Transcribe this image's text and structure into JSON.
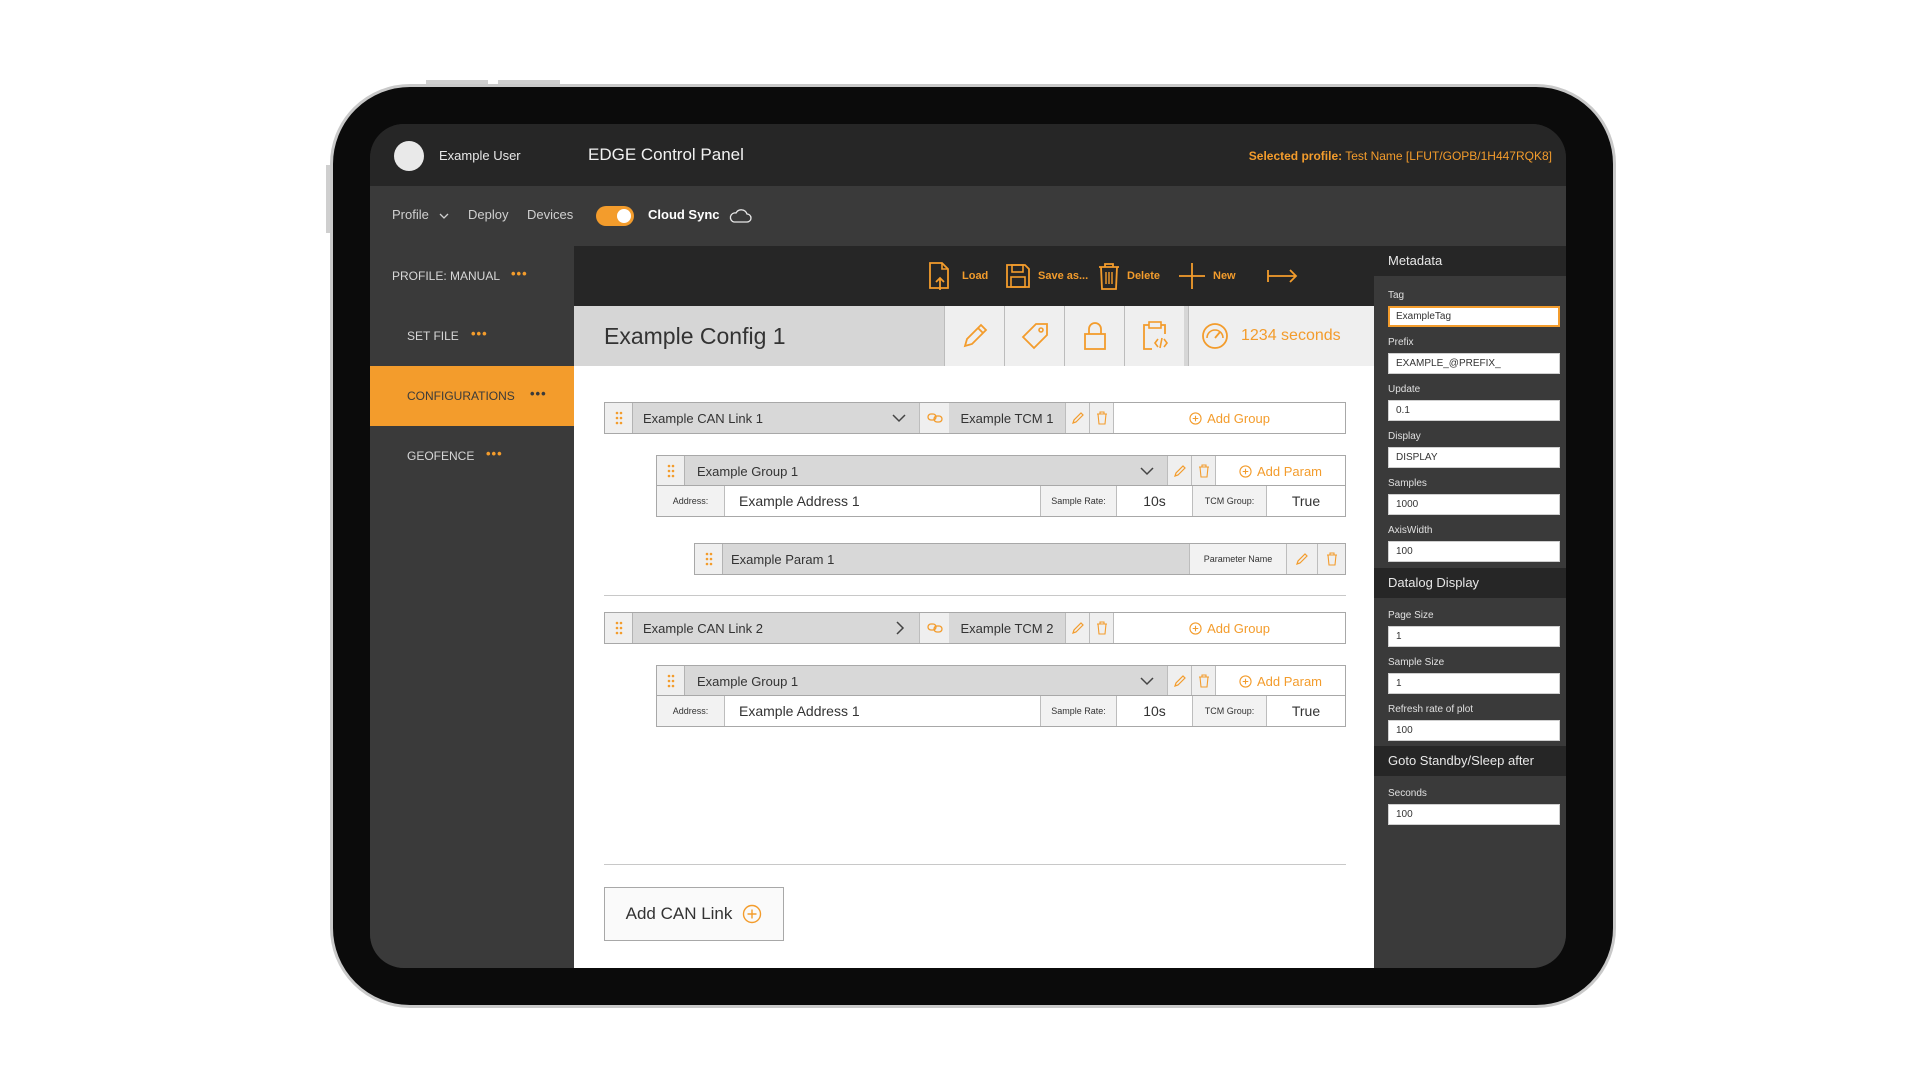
{
  "header": {
    "user_name": "Example User",
    "app_title": "EDGE Control Panel",
    "selected_profile_label": "Selected profile:",
    "selected_profile_value": "Test Name [LFUT/GOPB/1H447RQK8]"
  },
  "nav": {
    "profile": "Profile",
    "deploy": "Deploy",
    "devices": "Devices",
    "cloud_sync": "Cloud Sync",
    "cloud_sync_on": true
  },
  "sidebar": {
    "items": [
      {
        "label": "PROFILE: MANUAL",
        "dots": "•••"
      },
      {
        "label": "SET FILE",
        "dots": "•••"
      },
      {
        "label": "CONFIGURATIONS",
        "dots": "•••",
        "active": true
      },
      {
        "label": "GEOFENCE",
        "dots": "•••"
      }
    ]
  },
  "toolbar": {
    "load": "Load",
    "save_as": "Save as...",
    "delete": "Delete",
    "new": "New"
  },
  "config": {
    "title": "Example Config 1",
    "seconds": "1234 seconds"
  },
  "can_links": [
    {
      "name": "Example CAN Link 1",
      "tcm": "Example TCM 1",
      "add_group": "Add Group",
      "group": {
        "name": "Example Group 1",
        "add_param": "Add Param",
        "address_label": "Address:",
        "address": "Example Address 1",
        "sample_rate_label": "Sample Rate:",
        "sample_rate": "10s",
        "tcm_group_label": "TCM Group:",
        "tcm_group": "True"
      },
      "param": {
        "name": "Example Param 1",
        "label": "Parameter Name"
      }
    },
    {
      "name": "Example CAN Link 2",
      "tcm": "Example TCM 2",
      "add_group": "Add Group",
      "group": {
        "name": "Example Group 1",
        "add_param": "Add Param",
        "address_label": "Address:",
        "address": "Example Address 1",
        "sample_rate_label": "Sample Rate:",
        "sample_rate": "10s",
        "tcm_group_label": "TCM Group:",
        "tcm_group": "True"
      }
    }
  ],
  "add_can_link": "Add CAN Link",
  "metadata": {
    "heading": "Metadata",
    "fields": [
      {
        "label": "Tag",
        "value": "ExampleTag"
      },
      {
        "label": "Prefix",
        "value": "EXAMPLE_@PREFIX_"
      },
      {
        "label": "Update",
        "value": "0.1"
      },
      {
        "label": "Display",
        "value": "DISPLAY"
      },
      {
        "label": "Samples",
        "value": "1000"
      },
      {
        "label": "AxisWidth",
        "value": "100"
      }
    ],
    "datalog_heading": "Datalog Display",
    "datalog_fields": [
      {
        "label": "Page Size",
        "value": "1"
      },
      {
        "label": "Sample Size",
        "value": "1"
      },
      {
        "label": "Refresh rate of plot",
        "value": "100"
      }
    ],
    "standby_heading": "Goto Standby/Sleep after",
    "standby_fields": [
      {
        "label": "Seconds",
        "value": "100"
      }
    ]
  },
  "colors": {
    "accent": "#f39c2c",
    "dark": "#262626",
    "panel": "#3a3a3a"
  },
  "icons": [
    "chevron-down-icon",
    "cloud-icon",
    "load-icon",
    "save-icon",
    "trash-icon",
    "plus-icon",
    "arrow-right-bar-icon",
    "pencil-icon",
    "tag-icon",
    "lock-icon",
    "clipboard-code-icon",
    "gauge-icon",
    "drag-handle-icon",
    "link-icon",
    "plus-circle-icon",
    "chevron-right-icon"
  ]
}
